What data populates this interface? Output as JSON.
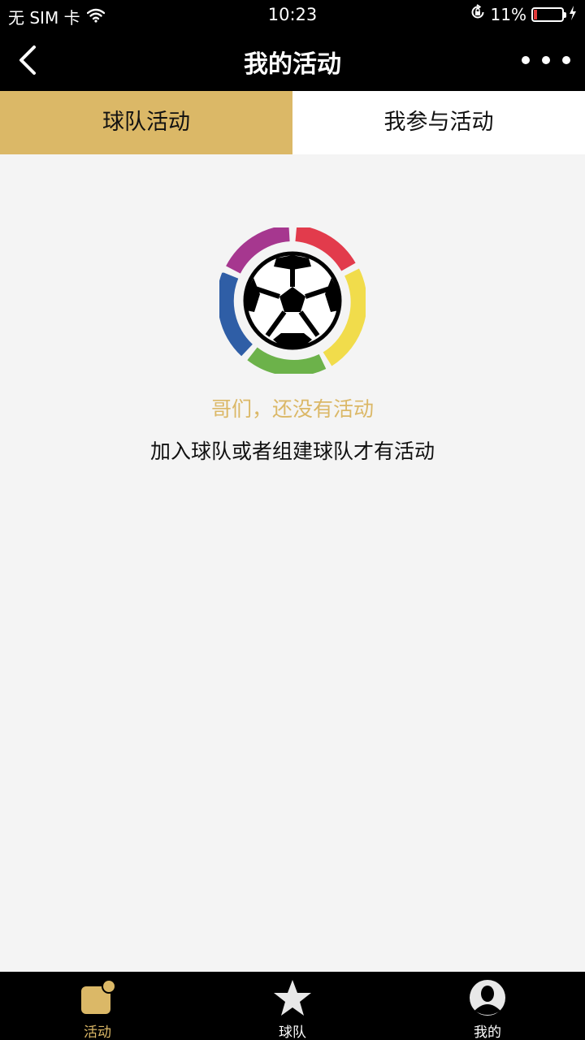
{
  "status_bar": {
    "carrier": "无 SIM 卡",
    "time": "10:23",
    "battery_percent": "11%",
    "battery_level": 0.11
  },
  "nav": {
    "title": "我的活动"
  },
  "tabs": [
    {
      "label": "球队活动",
      "active": true
    },
    {
      "label": "我参与活动",
      "active": false
    }
  ],
  "empty_state": {
    "title": "哥们，还没有活动",
    "subtitle": "加入球队或者组建球队才有活动"
  },
  "bottom_nav": [
    {
      "label": "活动",
      "icon": "activity-icon",
      "active": true
    },
    {
      "label": "球队",
      "icon": "star-icon",
      "active": false
    },
    {
      "label": "我的",
      "icon": "user-avatar-icon",
      "active": false
    }
  ],
  "colors": {
    "accent": "#dbb867",
    "bar_background": "#000000",
    "page_background": "#f4f4f4",
    "battery_low": "#e23b3b"
  }
}
